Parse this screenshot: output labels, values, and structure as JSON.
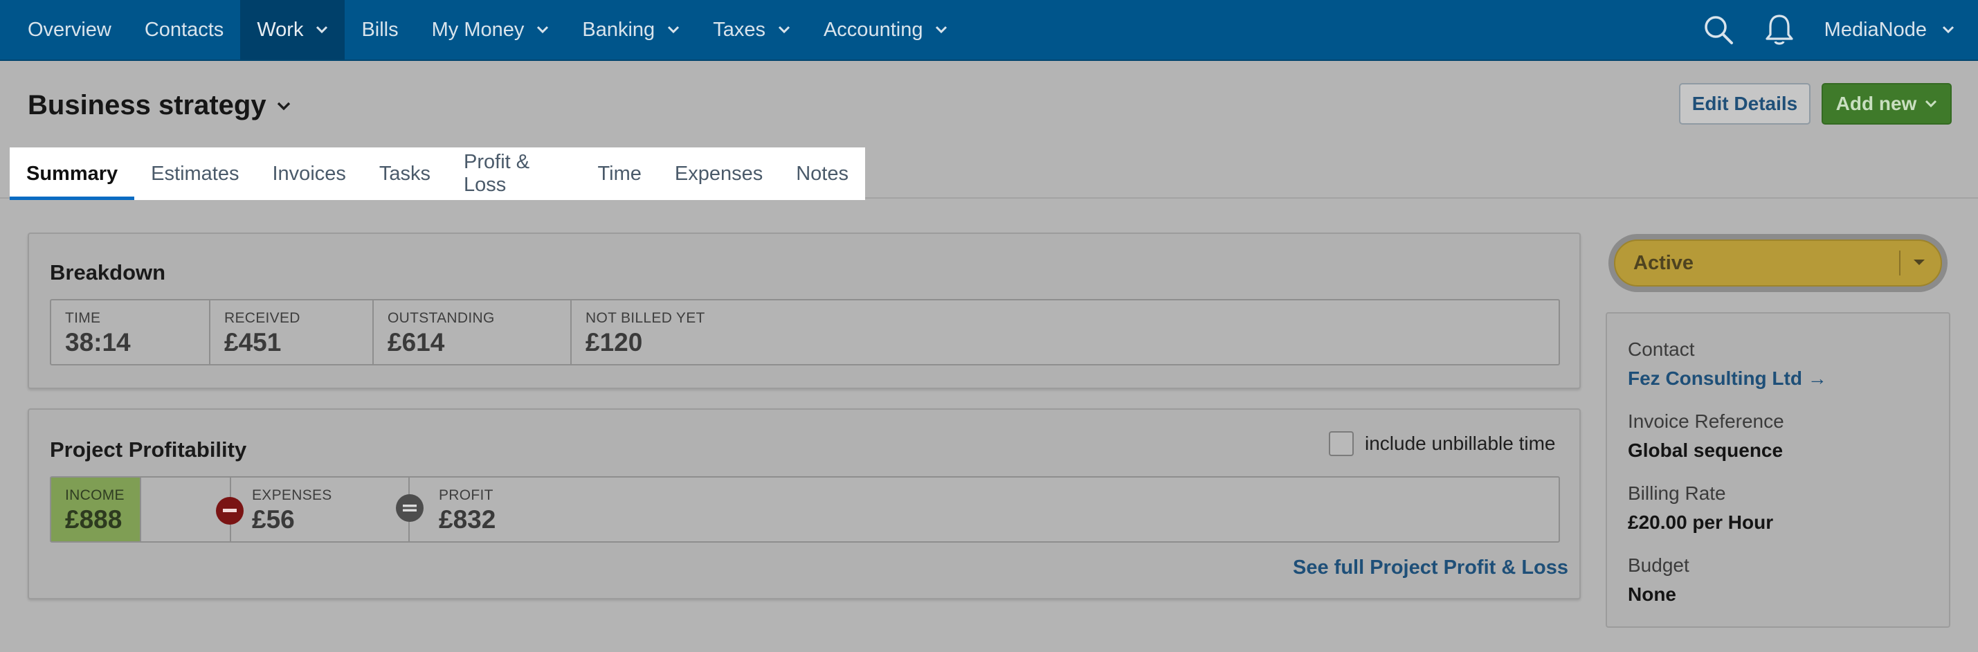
{
  "topnav": {
    "items": [
      {
        "label": "Overview",
        "dropdown": false
      },
      {
        "label": "Contacts",
        "dropdown": false
      },
      {
        "label": "Work",
        "dropdown": true,
        "active": true
      },
      {
        "label": "Bills",
        "dropdown": false
      },
      {
        "label": "My Money",
        "dropdown": true
      },
      {
        "label": "Banking",
        "dropdown": true
      },
      {
        "label": "Taxes",
        "dropdown": true
      },
      {
        "label": "Accounting",
        "dropdown": true
      }
    ],
    "account_name": "MediaNode",
    "icons": [
      "search-icon",
      "bell-icon"
    ]
  },
  "header": {
    "title": "Business strategy",
    "edit_label": "Edit Details",
    "add_label": "Add new"
  },
  "tabs": [
    "Summary",
    "Estimates",
    "Invoices",
    "Tasks",
    "Profit & Loss",
    "Time",
    "Expenses",
    "Notes"
  ],
  "breakdown": {
    "title": "Breakdown",
    "stats": [
      {
        "label": "TIME",
        "value": "38:14"
      },
      {
        "label": "RECEIVED",
        "value": "£451"
      },
      {
        "label": "OUTSTANDING",
        "value": "£614"
      },
      {
        "label": "NOT BILLED YET",
        "value": "£120"
      }
    ]
  },
  "profitability": {
    "title": "Project Profitability",
    "checkbox_label": "include unbillable time",
    "checkbox_checked": false,
    "income": {
      "label": "INCOME",
      "value": "£888"
    },
    "expenses": {
      "label": "EXPENSES",
      "value": "£56"
    },
    "profit": {
      "label": "PROFIT",
      "value": "£832"
    },
    "link": "See full Project Profit & Loss"
  },
  "sidebar": {
    "status": "Active",
    "details": [
      {
        "label": "Contact",
        "value": "Fez Consulting Ltd →",
        "is_link": true
      },
      {
        "label": "Invoice Reference",
        "value": "Global sequence"
      },
      {
        "label": "Billing Rate",
        "value": "£20.00 per Hour"
      },
      {
        "label": "Budget",
        "value": "None"
      }
    ]
  },
  "colors": {
    "nav_bg": "#00558b",
    "accent_blue": "#0a6bc2",
    "add_button": "#3f7a2a",
    "status_active": "#b69a38",
    "income_green": "#7f9e54"
  }
}
